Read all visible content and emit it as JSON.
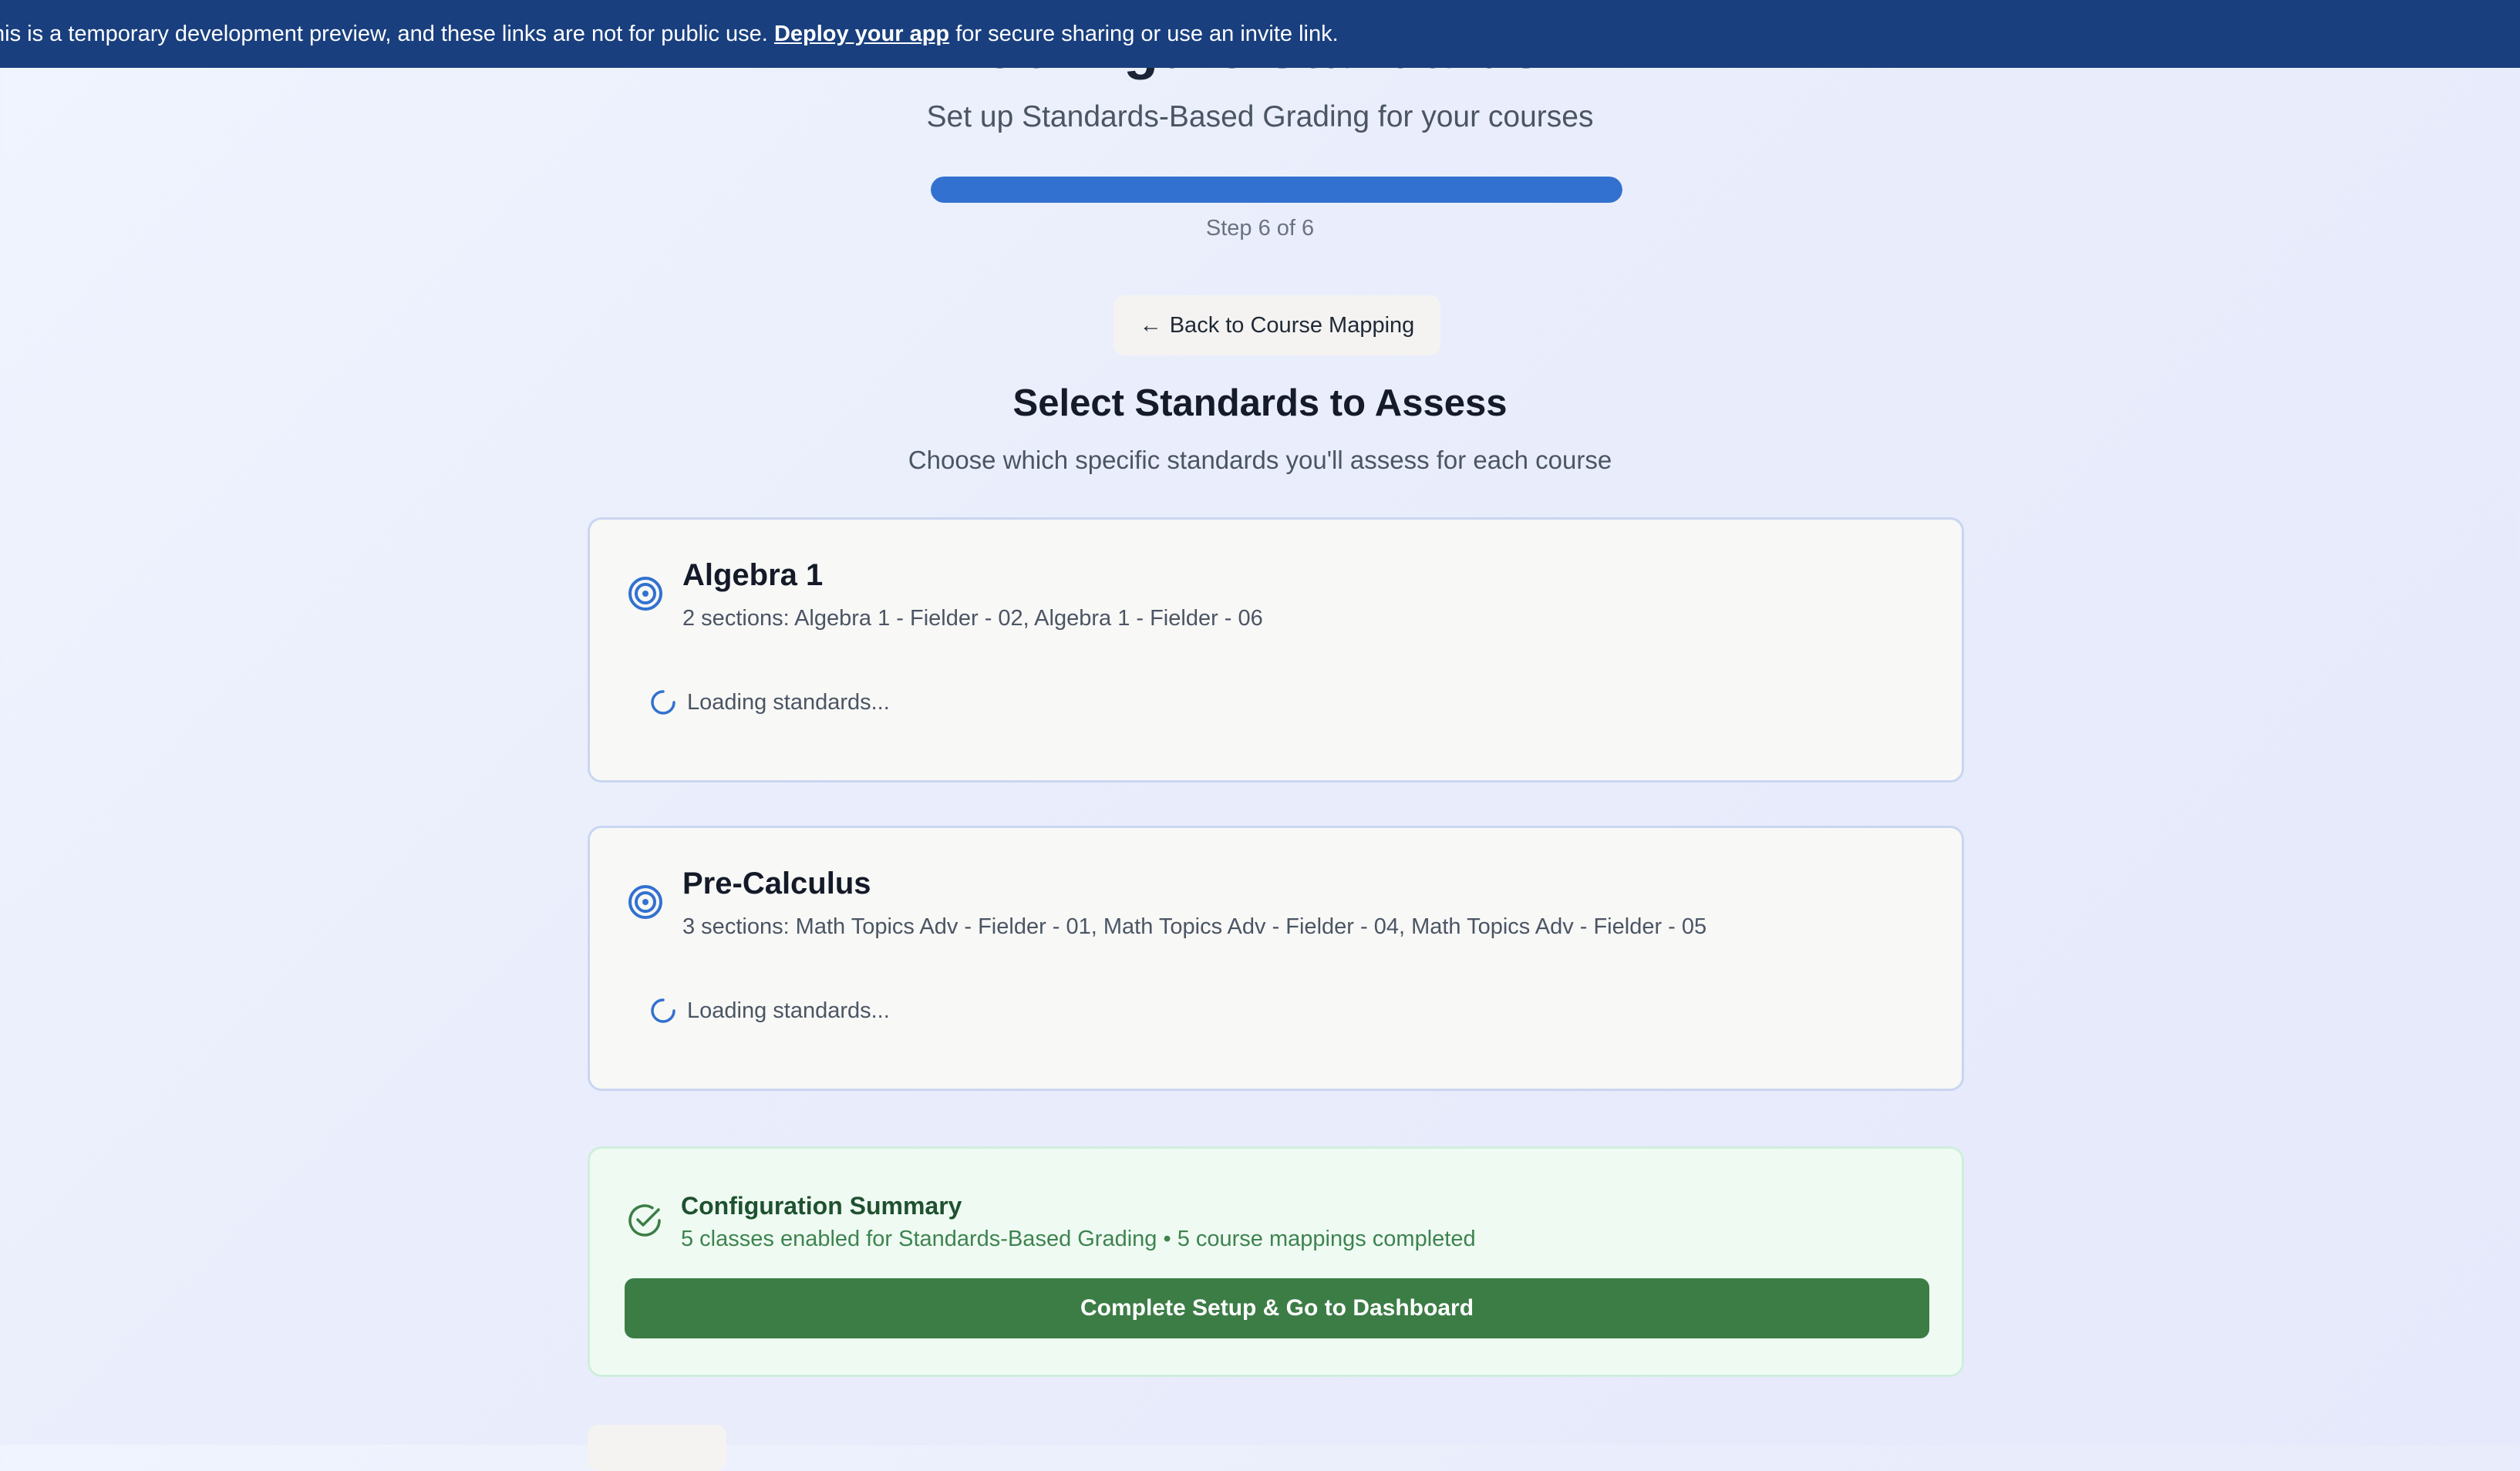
{
  "banner": {
    "text_before": "his is a temporary development preview, and these links are not for public use.",
    "link_label": "Deploy your app",
    "text_after": "for secure sharing or use an invite link."
  },
  "header": {
    "title": "Configure Standards",
    "subtitle": "Set up Standards-Based Grading for your courses",
    "progress_fraction": 1.0,
    "step_label": "Step 6 of 6"
  },
  "back_button": {
    "arrow": "←",
    "label": "Back to Course Mapping"
  },
  "section": {
    "title": "Select Standards to Assess",
    "subtitle": "Choose which specific standards you'll assess for each course"
  },
  "courses": [
    {
      "name": "Algebra 1",
      "sections": "2 sections: Algebra 1 - Fielder - 02, Algebra 1 - Fielder - 06",
      "loading": "Loading standards...",
      "icon": "target-icon"
    },
    {
      "name": "Pre-Calculus",
      "sections": "3 sections: Math Topics Adv - Fielder - 01, Math Topics Adv - Fielder - 04, Math Topics Adv - Fielder - 05",
      "loading": "Loading standards...",
      "icon": "target-icon"
    }
  ],
  "summary": {
    "title": "Configuration Summary",
    "detail": "5 classes enabled for Standards-Based Grading • 5 course mappings completed",
    "button_label": "Complete Setup & Go to Dashboard",
    "icon": "check-circle-icon"
  },
  "colors": {
    "banner": "#193f7e",
    "accent": "#3271cf",
    "success": "#3c7d46"
  }
}
